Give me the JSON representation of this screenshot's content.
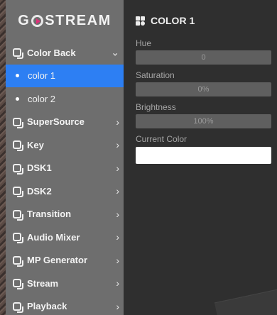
{
  "app": {
    "logo_text_before": "G",
    "logo_text_after": "STREAM"
  },
  "sidebar": {
    "items": [
      {
        "label": "Color Back",
        "chevron": "⌄",
        "expanded": true,
        "children": [
          {
            "label": "color 1",
            "active": true
          },
          {
            "label": "color 2",
            "active": false
          }
        ]
      },
      {
        "label": "SuperSource",
        "chevron": "›"
      },
      {
        "label": "Key",
        "chevron": "›"
      },
      {
        "label": "DSK1",
        "chevron": "›"
      },
      {
        "label": "DSK2",
        "chevron": "›"
      },
      {
        "label": "Transition",
        "chevron": "›"
      },
      {
        "label": "Audio Mixer",
        "chevron": "›"
      },
      {
        "label": "MP Generator",
        "chevron": "›"
      },
      {
        "label": "Stream",
        "chevron": "›"
      },
      {
        "label": "Playback",
        "chevron": "›"
      }
    ]
  },
  "main": {
    "title": "COLOR 1",
    "fields": {
      "hue": {
        "label": "Hue",
        "value": "0"
      },
      "saturation": {
        "label": "Saturation",
        "value": "0%"
      },
      "brightness": {
        "label": "Brightness",
        "value": "100%"
      },
      "current_color": {
        "label": "Current Color",
        "color": "#ffffff"
      }
    }
  },
  "colors": {
    "accent": "#2d7ff3",
    "sidebar_bg": "#6e6e6e",
    "main_bg": "#2f2f2f"
  }
}
